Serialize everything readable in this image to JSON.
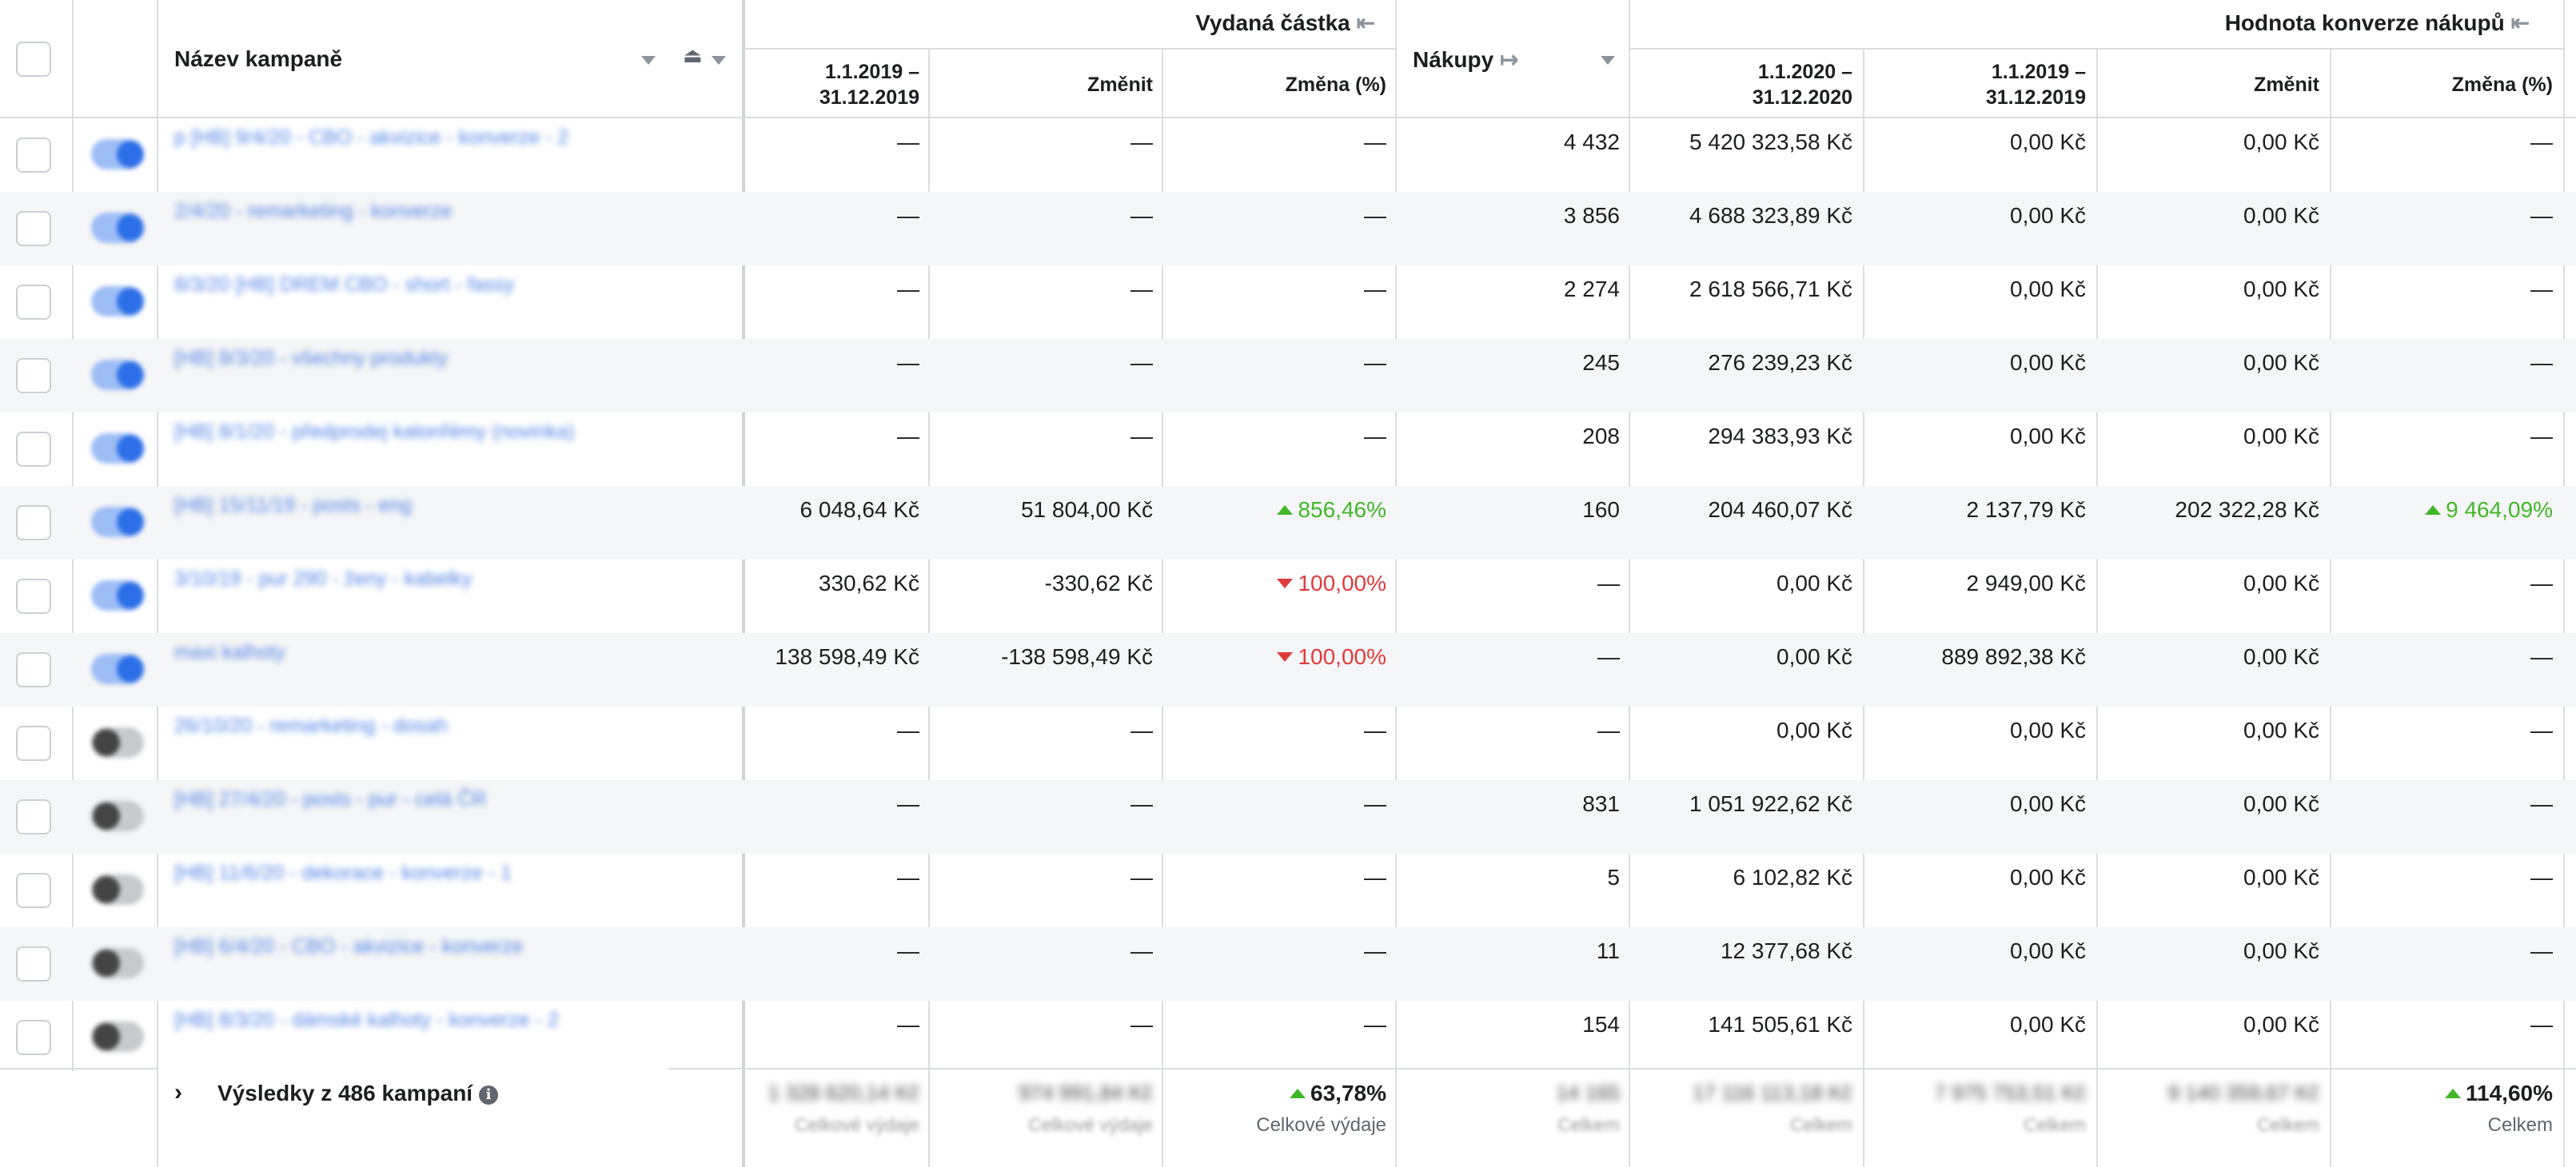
{
  "header": {
    "campaign_name": "Název kampaně",
    "group_spend": "Vydaná částka",
    "group_conv": "Hodnota konverze nákupů",
    "purchases": "Nákupy",
    "col_2019": "1.1.2019 –\n31.12.2019",
    "col_2020": "1.1.2020 –\n31.12.2020",
    "col_change": "Změnit",
    "col_change_pct": "Změna (%)"
  },
  "rows": [
    {
      "name": "p [HB] 9/4/20 - CBO - akvizice - konverze - 2",
      "active": true,
      "spend_2019": "—",
      "spend_change": "—",
      "spend_pct": "—",
      "spend_dir": "",
      "purchases": "4 432",
      "conv_2020": "5 420 323,58 Kč",
      "conv_2019": "0,00 Kč",
      "conv_change": "0,00 Kč",
      "conv_pct": "—",
      "conv_dir": ""
    },
    {
      "name": "2/4/20 - remarketing - konverze",
      "active": true,
      "spend_2019": "—",
      "spend_change": "—",
      "spend_pct": "—",
      "spend_dir": "",
      "purchases": "3 856",
      "conv_2020": "4 688 323,89 Kč",
      "conv_2019": "0,00 Kč",
      "conv_change": "0,00 Kč",
      "conv_pct": "—",
      "conv_dir": ""
    },
    {
      "name": "8/3/20 [HB] DREM CBO - short - fassy",
      "active": true,
      "spend_2019": "—",
      "spend_change": "—",
      "spend_pct": "—",
      "spend_dir": "",
      "purchases": "2 274",
      "conv_2020": "2 618 566,71 Kč",
      "conv_2019": "0,00 Kč",
      "conv_change": "0,00 Kč",
      "conv_pct": "—",
      "conv_dir": ""
    },
    {
      "name": "[HB] 8/3/20 - všechny produkty",
      "active": true,
      "spend_2019": "—",
      "spend_change": "—",
      "spend_pct": "—",
      "spend_dir": "",
      "purchases": "245",
      "conv_2020": "276 239,23 Kč",
      "conv_2019": "0,00 Kč",
      "conv_change": "0,00 Kč",
      "conv_pct": "—",
      "conv_dir": ""
    },
    {
      "name": "[HB] 8/1/20 - předprodej katonřémy (novinka)",
      "active": true,
      "spend_2019": "—",
      "spend_change": "—",
      "spend_pct": "—",
      "spend_dir": "",
      "purchases": "208",
      "conv_2020": "294 383,93 Kč",
      "conv_2019": "0,00 Kč",
      "conv_change": "0,00 Kč",
      "conv_pct": "—",
      "conv_dir": ""
    },
    {
      "name": "[HB] 15/11/19 - posts - eng",
      "active": true,
      "spend_2019": "6 048,64 Kč",
      "spend_change": "51 804,00 Kč",
      "spend_pct": "856,46%",
      "spend_dir": "up",
      "purchases": "160",
      "conv_2020": "204 460,07 Kč",
      "conv_2019": "2 137,79 Kč",
      "conv_change": "202 322,28 Kč",
      "conv_pct": "9 464,09%",
      "conv_dir": "up"
    },
    {
      "name": "3/10/19 - pur 290 - ženy - kabelky",
      "active": true,
      "spend_2019": "330,62 Kč",
      "spend_change": "-330,62 Kč",
      "spend_pct": "100,00%",
      "spend_dir": "down",
      "purchases": "—",
      "conv_2020": "0,00 Kč",
      "conv_2019": "2 949,00 Kč",
      "conv_change": "0,00 Kč",
      "conv_pct": "—",
      "conv_dir": ""
    },
    {
      "name": "maxi kalhoty",
      "active": true,
      "spend_2019": "138 598,49 Kč",
      "spend_change": "-138 598,49 Kč",
      "spend_pct": "100,00%",
      "spend_dir": "down",
      "purchases": "—",
      "conv_2020": "0,00 Kč",
      "conv_2019": "889 892,38 Kč",
      "conv_change": "0,00 Kč",
      "conv_pct": "—",
      "conv_dir": ""
    },
    {
      "name": "26/10/20 - remarketing - dosah",
      "active": false,
      "spend_2019": "—",
      "spend_change": "—",
      "spend_pct": "—",
      "spend_dir": "",
      "purchases": "—",
      "conv_2020": "0,00 Kč",
      "conv_2019": "0,00 Kč",
      "conv_change": "0,00 Kč",
      "conv_pct": "—",
      "conv_dir": ""
    },
    {
      "name": "[HB] 27/4/20 - posts - pur - celá ČR",
      "active": false,
      "spend_2019": "—",
      "spend_change": "—",
      "spend_pct": "—",
      "spend_dir": "",
      "purchases": "831",
      "conv_2020": "1 051 922,62 Kč",
      "conv_2019": "0,00 Kč",
      "conv_change": "0,00 Kč",
      "conv_pct": "—",
      "conv_dir": ""
    },
    {
      "name": "[HB] 11/6/20 - dekorace - konverze - 1",
      "active": false,
      "spend_2019": "—",
      "spend_change": "—",
      "spend_pct": "—",
      "spend_dir": "",
      "purchases": "5",
      "conv_2020": "6 102,82 Kč",
      "conv_2019": "0,00 Kč",
      "conv_change": "0,00 Kč",
      "conv_pct": "—",
      "conv_dir": ""
    },
    {
      "name": "[HB] 6/4/20 - CBO - akvizice - konverze",
      "active": false,
      "spend_2019": "—",
      "spend_change": "—",
      "spend_pct": "—",
      "spend_dir": "",
      "purchases": "11",
      "conv_2020": "12 377,68 Kč",
      "conv_2019": "0,00 Kč",
      "conv_change": "0,00 Kč",
      "conv_pct": "—",
      "conv_dir": ""
    },
    {
      "name": "[HB] 8/3/20 - dámské kalhoty - konverze - 2",
      "active": false,
      "spend_2019": "—",
      "spend_change": "—",
      "spend_pct": "—",
      "spend_dir": "",
      "purchases": "154",
      "conv_2020": "141 505,61 Kč",
      "conv_2019": "0,00 Kč",
      "conv_change": "0,00 Kč",
      "conv_pct": "—",
      "conv_dir": ""
    }
  ],
  "footer": {
    "label": "Výsledky z 486 kampaní",
    "spend_2019": "1 328 620,14 Kč",
    "spend_2019_sub": "Celkové výdaje",
    "spend_change": "974 991,84 Kč",
    "spend_change_sub": "Celkové výdaje",
    "spend_pct": "63,78%",
    "spend_pct_sub": "Celkové výdaje",
    "purchases": "14 165",
    "purchases_sub": "Celkem",
    "conv_2020": "17 116 113,18 Kč",
    "conv_2020_sub": "Celkem",
    "conv_2019": "7 975 753,51 Kč",
    "conv_2019_sub": "Celkem",
    "conv_change": "9 140 359,67 Kč",
    "conv_change_sub": "Celkem",
    "conv_pct": "114,60%",
    "conv_pct_sub": "Celkem"
  },
  "colors": {
    "border": "#dadde1",
    "alt_row": "#f5f6f7",
    "up": "#42b72a",
    "down": "#e03b3b",
    "toggle_on": "#2d6fe8"
  }
}
